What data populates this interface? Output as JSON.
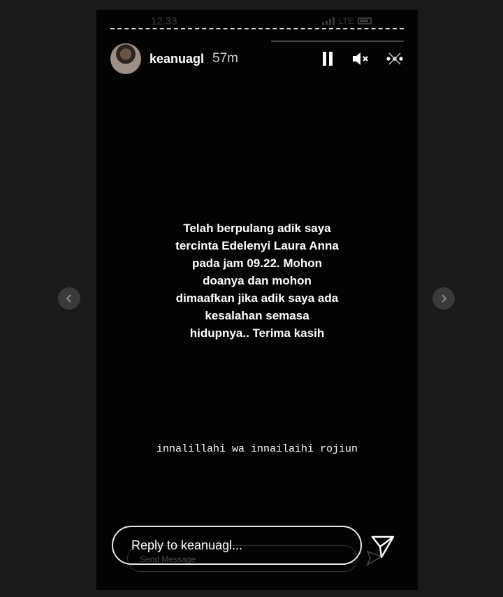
{
  "statusbar": {
    "time": "12.33",
    "network": "LTE"
  },
  "header": {
    "username": "keanuagl",
    "time_ago": "57m"
  },
  "icons": {
    "pause": "pause-icon",
    "mute": "speaker-muted-icon",
    "more": "more-icon",
    "send": "send-icon",
    "prev": "chevron-left-icon",
    "next": "chevron-right-icon"
  },
  "story": {
    "message": "Telah berpulang adik saya\ntercinta Edelenyi Laura Anna\npada jam 09.22. Mohon\ndoanya dan mohon\ndimaafkan jika adik saya ada\nkesalahan semasa\nhidupnya.. Terima kasih",
    "subtext": "innalillahi wa innailaihi rojiun"
  },
  "reply": {
    "placeholder": "Reply to keanuagl...",
    "ghost_placeholder": "Send Message"
  },
  "colors": {
    "page_background": "#1a1a1a",
    "story_background": "#030303",
    "text": "#ffffff"
  }
}
